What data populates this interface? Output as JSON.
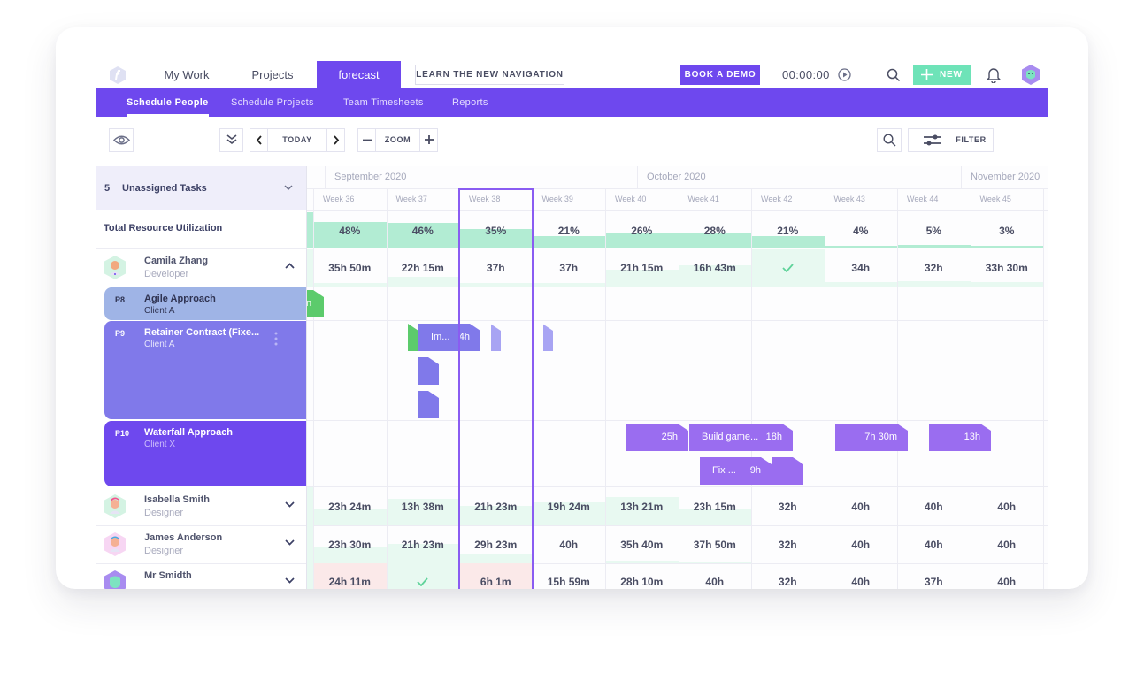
{
  "topnav": {
    "items": [
      "My Work",
      "Projects",
      "forecast"
    ],
    "active": "forecast",
    "learn_label": "LEARN THE NEW NAVIGATION",
    "demo_label": "BOOK A DEMO",
    "timer": "00:00:00",
    "new_label": "NEW"
  },
  "subnav": {
    "items": [
      "Schedule People",
      "Schedule Projects",
      "Team Timesheets",
      "Reports"
    ],
    "active": "Schedule People"
  },
  "toolbar": {
    "today_label": "TODAY",
    "zoom_label": "ZOOM",
    "filter_label": "FILTER"
  },
  "colors": {
    "brand": "#6e48ee",
    "new_button": "#6ee3b8",
    "utilization_bar": "#b2ecd3",
    "overbooked": "#fbe9e9",
    "project_p8": "#9fb4e6",
    "project_p9": "#8079ea",
    "project_p10": "#6e48ee"
  },
  "unassigned": {
    "count": "5",
    "label": "Unassigned Tasks"
  },
  "months": [
    "September 2020",
    "October 2020",
    "November 2020"
  ],
  "weeks": [
    "Week 36",
    "Week 37",
    "Week 38",
    "Week 39",
    "Week 40",
    "Week 41",
    "Week 42",
    "Week 43",
    "Week 44",
    "Week 45"
  ],
  "current_week": "Week 38",
  "utilization": {
    "label": "Total Resource Utilization",
    "values": [
      "48%",
      "46%",
      "35%",
      "21%",
      "26%",
      "28%",
      "21%",
      "4%",
      "5%",
      "3%"
    ]
  },
  "people": [
    {
      "name": "Camila Zhang",
      "role": "Developer",
      "expanded": true,
      "hours": [
        "35h 50m",
        "22h 15m",
        "37h",
        "37h",
        "21h 15m",
        "16h 43m",
        "check",
        "34h",
        "32h",
        "33h 30m"
      ],
      "projects": [
        {
          "id": "P8",
          "name": "Agile Approach",
          "client": "Client A"
        },
        {
          "id": "P9",
          "name": "Retainer Contract (Fixe...",
          "client": "Client A"
        },
        {
          "id": "P10",
          "name": "Waterfall Approach",
          "client": "Client X"
        }
      ]
    },
    {
      "name": "Isabella Smith",
      "role": "Designer",
      "expanded": false,
      "hours": [
        "23h 24m",
        "13h 38m",
        "21h 23m",
        "19h 24m",
        "13h 21m",
        "23h 15m",
        "32h",
        "40h",
        "40h",
        "40h"
      ]
    },
    {
      "name": "James Anderson",
      "role": "Designer",
      "expanded": false,
      "hours": [
        "23h 30m",
        "21h 23m",
        "29h 23m",
        "40h",
        "35h 40m",
        "37h 50m",
        "32h",
        "40h",
        "40h",
        "40h"
      ]
    },
    {
      "name": "Mr Smidth",
      "role": "",
      "expanded": false,
      "hours": [
        "24h 11m",
        "check",
        "6h 1m",
        "15h 59m",
        "28h 10m",
        "40h",
        "32h",
        "40h",
        "37h",
        "40h"
      ]
    }
  ],
  "allocations": {
    "p8": [
      {
        "label": "n",
        "hours": ""
      }
    ],
    "p9": [
      {
        "label": "Im...",
        "hours": "4h"
      }
    ],
    "p10": [
      {
        "label": "",
        "hours": "25h"
      },
      {
        "label": "Build game...",
        "hours": "18h"
      },
      {
        "label": "Fix ...",
        "hours": "9h"
      },
      {
        "label": "",
        "hours": "7h 30m"
      },
      {
        "label": "",
        "hours": "13h"
      }
    ]
  }
}
